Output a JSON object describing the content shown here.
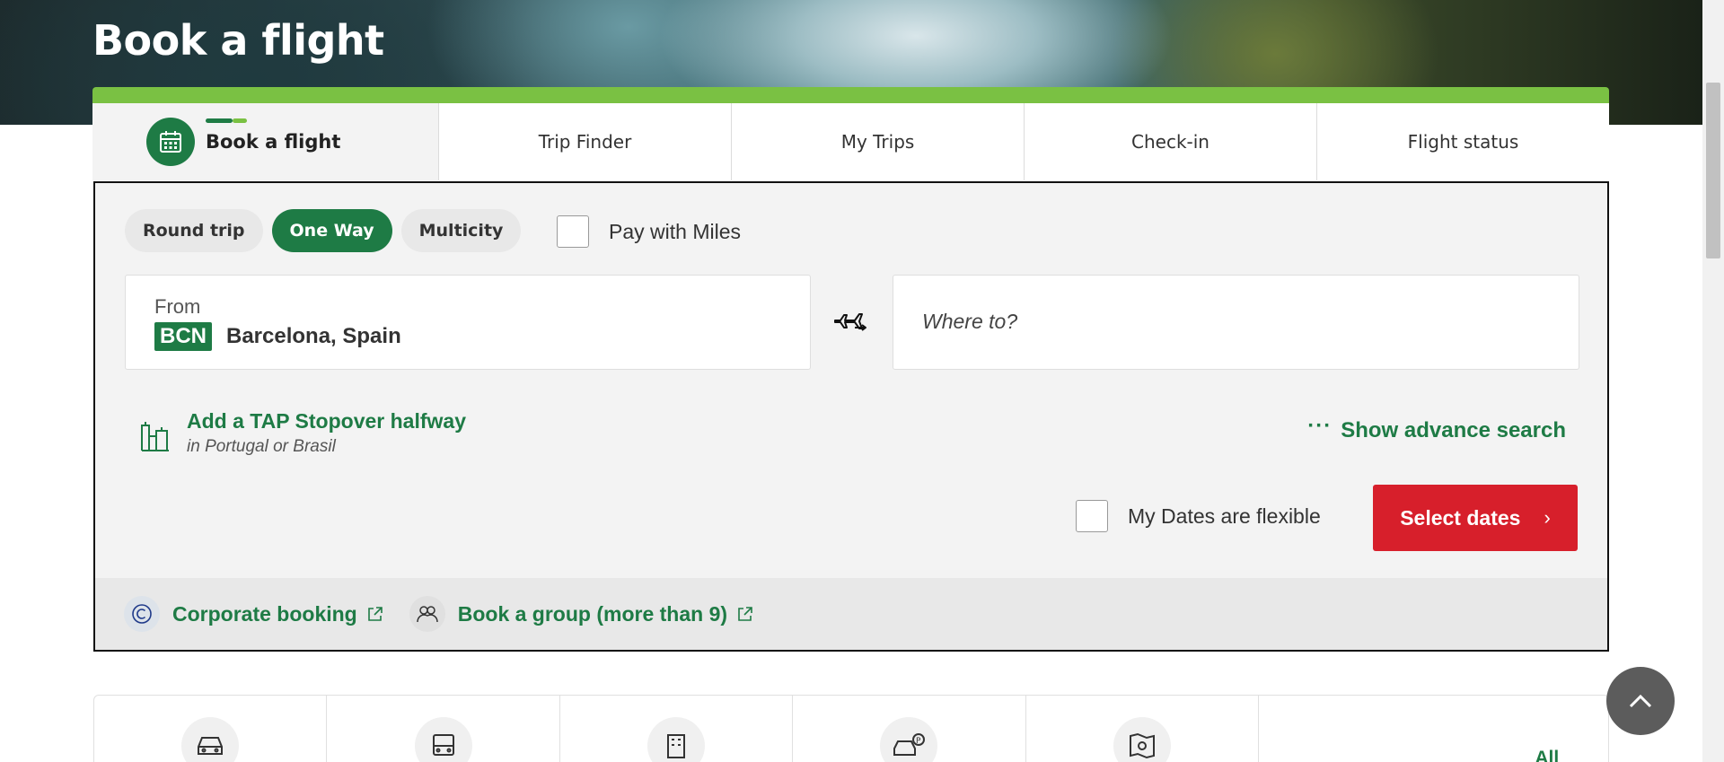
{
  "hero": {
    "title": "Book a flight"
  },
  "tabs": [
    {
      "label": "Book a flight",
      "active": true
    },
    {
      "label": "Trip Finder"
    },
    {
      "label": "My Trips"
    },
    {
      "label": "Check-in"
    },
    {
      "label": "Flight status"
    }
  ],
  "booking": {
    "trip_types": [
      "Round trip",
      "One Way",
      "Multicity"
    ],
    "selected_trip_type": "One Way",
    "pay_with_miles_label": "Pay with Miles",
    "from_label": "From",
    "from_code": "BCN",
    "from_city": "Barcelona, Spain",
    "to_placeholder": "Where to?",
    "stopover_title": "Add a TAP Stopover halfway",
    "stopover_sub": "in Portugal or Brasil",
    "advance_search": "Show advance search",
    "flexible_dates_label": "My Dates are flexible",
    "select_dates_button": "Select dates",
    "corporate_booking": "Corporate booking",
    "group_booking": "Book a group (more than 9)"
  },
  "lower_bar": {
    "all_options": "All booking options"
  },
  "colors": {
    "brand_green": "#1e7b45",
    "accent_green": "#7ac143",
    "cta_red": "#d71f2b"
  }
}
